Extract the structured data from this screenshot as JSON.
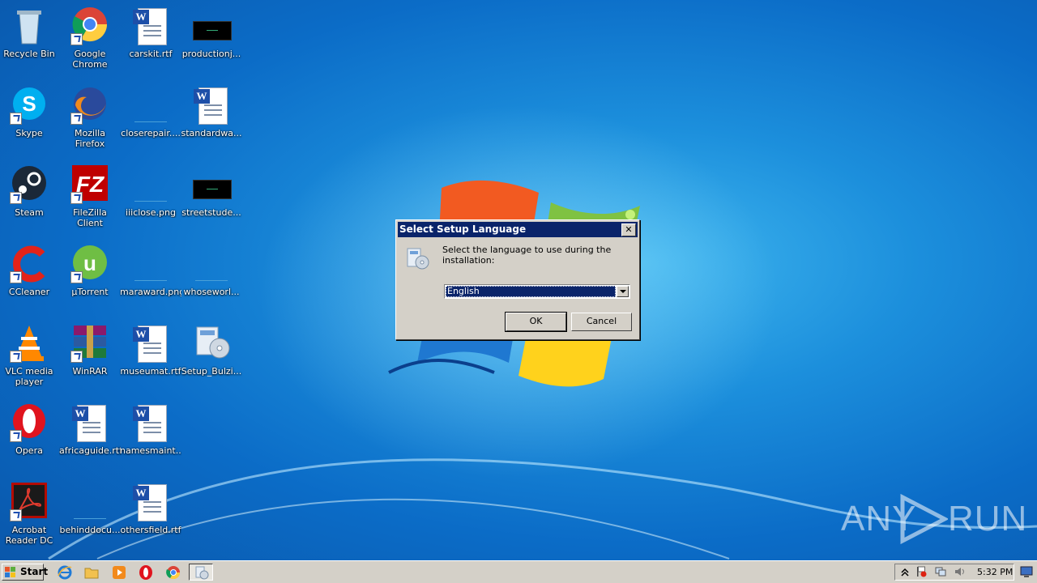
{
  "desktop": {
    "icons": [
      {
        "label": "Recycle Bin",
        "icon": "recycle-bin-icon"
      },
      {
        "label": "Google Chrome",
        "icon": "chrome-icon"
      },
      {
        "label": "carskit.rtf",
        "icon": "word-document-icon"
      },
      {
        "label": "productionj...",
        "icon": "black-image-thumbnail-icon"
      },
      {
        "label": "Skype",
        "icon": "skype-icon"
      },
      {
        "label": "Mozilla Firefox",
        "icon": "firefox-icon"
      },
      {
        "label": "closerepair....",
        "icon": "blank-file-icon"
      },
      {
        "label": "standardwa...",
        "icon": "word-document-icon"
      },
      {
        "label": "Steam",
        "icon": "steam-icon"
      },
      {
        "label": "FileZilla Client",
        "icon": "filezilla-icon"
      },
      {
        "label": "iiiclose.png",
        "icon": "blank-file-icon"
      },
      {
        "label": "streetstude...",
        "icon": "black-image-thumbnail-icon"
      },
      {
        "label": "CCleaner",
        "icon": "ccleaner-icon"
      },
      {
        "label": "µTorrent",
        "icon": "utorrent-icon"
      },
      {
        "label": "maraward.png",
        "icon": "blank-file-icon"
      },
      {
        "label": "whoseworl...",
        "icon": "blank-file-icon"
      },
      {
        "label": "VLC media player",
        "icon": "vlc-icon"
      },
      {
        "label": "WinRAR",
        "icon": "winrar-icon"
      },
      {
        "label": "museumat.rtf",
        "icon": "word-document-icon"
      },
      {
        "label": "Setup_Bulzi...",
        "icon": "setup-installer-icon"
      },
      {
        "label": "Opera",
        "icon": "opera-icon"
      },
      {
        "label": "africaguide.rtf",
        "icon": "word-document-icon"
      },
      {
        "label": "namesmaint...",
        "icon": "word-document-icon"
      },
      {
        "label": "Acrobat Reader DC",
        "icon": "acrobat-icon"
      },
      {
        "label": "behinddocu...",
        "icon": "blank-file-icon"
      },
      {
        "label": "othersfield.rtf",
        "icon": "word-document-icon"
      }
    ]
  },
  "dialog": {
    "title": "Select Setup Language",
    "close_label": "✕",
    "message": "Select the language to use during the installation:",
    "language_selected": "English",
    "ok_label": "OK",
    "cancel_label": "Cancel"
  },
  "watermark": {
    "text_left": "ANY",
    "text_right": "RUN"
  },
  "taskbar": {
    "start_label": "Start",
    "quick_launch": [
      "internet-explorer-icon",
      "folder-icon",
      "media-player-icon",
      "opera-icon",
      "chrome-icon"
    ],
    "active_task_icon": "setup-installer-icon",
    "clock": "5:32 PM"
  },
  "colors": {
    "desktop_blue": "#1c8fdc",
    "title_bar": "#0a246a",
    "dialog_face": "#d4d0c8"
  }
}
